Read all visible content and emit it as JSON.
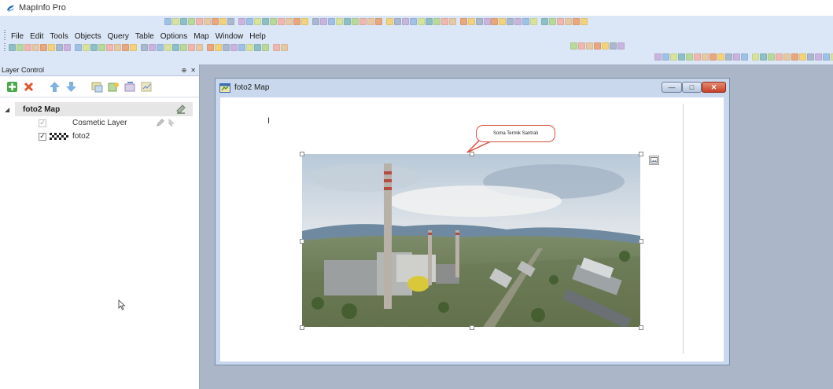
{
  "app": {
    "title": "MapInfo Pro"
  },
  "menu": {
    "items": [
      "File",
      "Edit",
      "Tools",
      "Objects",
      "Query",
      "Table",
      "Options",
      "Map",
      "Window",
      "Help"
    ]
  },
  "toolbars": {
    "icons": [
      "select-icon",
      "zoom-in-icon",
      "zoom-out-icon",
      "grabber-icon",
      "info-icon",
      "label-icon",
      "ruler-icon",
      "layer-control-icon",
      "open-table-icon",
      "save-icon",
      "print-icon",
      "new-browser-icon",
      "new-mapper-icon",
      "draw-line-icon",
      "draw-polygon-icon",
      "text-tool-icon"
    ]
  },
  "layer_control": {
    "title": "Layer Control",
    "pin_glyph": "⊕",
    "close_glyph": "✕",
    "toolbar_icons": [
      "add-layer-icon",
      "remove-layer-icon",
      "move-up-icon",
      "move-down-icon",
      "layer-properties-icon",
      "display-options-icon",
      "label-options-icon",
      "thematic-icon"
    ],
    "group_expander": "◢",
    "group_name": "foto2 Map",
    "layers": [
      {
        "name": "Cosmetic Layer",
        "checked": true,
        "editable": false
      },
      {
        "name": "foto2",
        "checked": true,
        "editable": true
      }
    ]
  },
  "map_window": {
    "title": "foto2 Map",
    "controls": {
      "minimize": "—",
      "maximize": "□",
      "close": "✕"
    },
    "cursor_text": "I",
    "callout_label": "Soma Termik Santrali",
    "image_layer": "foto2"
  },
  "colors": {
    "toolbar_bg": "#dbe6f6",
    "workspace_bg": "#abb6c8",
    "window_frame": "#c9d8ec",
    "callout_border": "#d84d3f",
    "close_button": "#c8412a"
  }
}
